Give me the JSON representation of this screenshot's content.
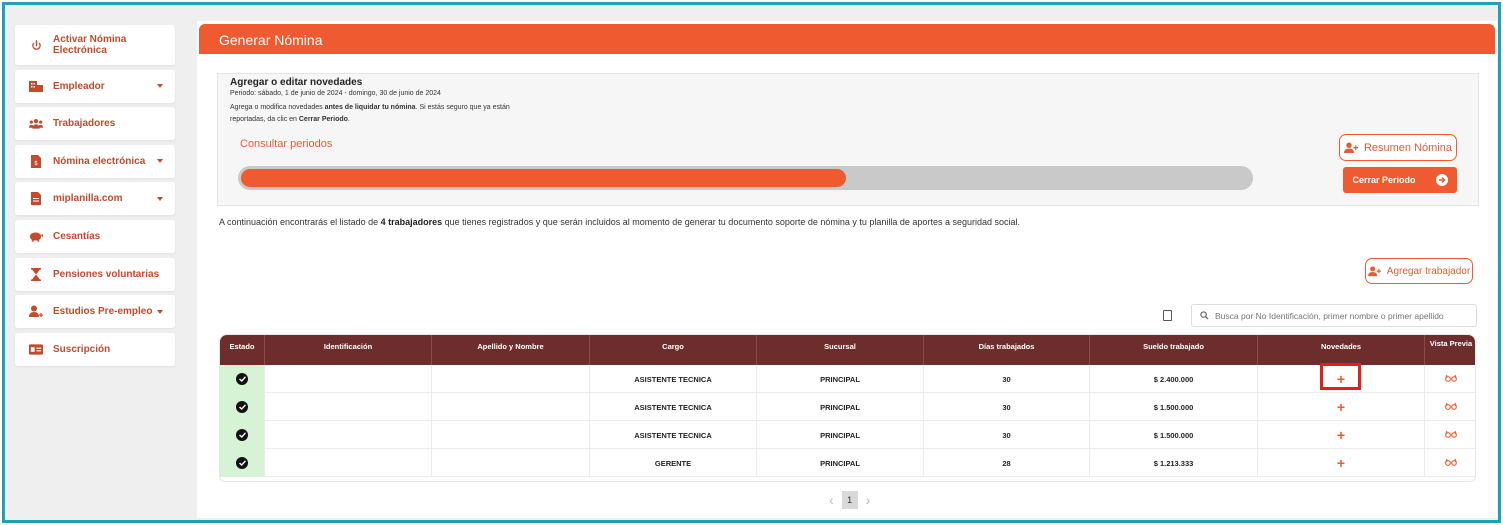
{
  "sidebar": {
    "items": [
      {
        "label": "Activar Nómina Electrónica",
        "icon": "power-icon",
        "dropdown": false
      },
      {
        "label": "Empleador",
        "icon": "building-icon",
        "dropdown": true
      },
      {
        "label": "Trabajadores",
        "icon": "users-icon",
        "dropdown": false
      },
      {
        "label": "Nómina electrónica",
        "icon": "document-icon",
        "dropdown": true
      },
      {
        "label": "miplanilla.com",
        "icon": "file-icon",
        "dropdown": true
      },
      {
        "label": "Cesantías",
        "icon": "piggy-bank-icon",
        "dropdown": false
      },
      {
        "label": "Pensiones voluntarias",
        "icon": "hourglass-icon",
        "dropdown": false
      },
      {
        "label": "Estudios Pre-empleo",
        "icon": "user-plus-icon",
        "dropdown": true
      },
      {
        "label": "Suscripción",
        "icon": "id-card-icon",
        "dropdown": false
      }
    ]
  },
  "header": {
    "title": "Generar Nómina"
  },
  "info": {
    "heading": "Agregar o editar novedades",
    "periodo": "Periodo: sábado, 1 de junio de 2024 - domingo, 30 de junio de 2024",
    "instr_1": "Agrega o modifica novedades ",
    "instr_bold": "antes de liquidar tu nómina",
    "instr_2": ". Si estás seguro que ya están reportadas, da clic en ",
    "instr_bold2": "Cerrar Periodo",
    "instr_3": ".",
    "consultar": "Consultar periodos",
    "progress_fraction": 0.6
  },
  "buttons": {
    "resumen": "Resumen Nómina",
    "cerrar": "Cerrar Periodo",
    "agregar": "Agregar trabajador"
  },
  "description": {
    "pre": "A continuación encontrarás el listado de ",
    "bold": "4 trabajadores",
    "post": " que tienes registrados y que serán incluidos al momento de generar tu documento soporte de nómina y tu planilla de aportes a seguridad social."
  },
  "search": {
    "placeholder": "Busca por No Identificación, primer nombre o primer apellido"
  },
  "table": {
    "headers": [
      "Estado",
      "Identificación",
      "Apellido y Nombre",
      "Cargo",
      "Sucursal",
      "Días trabajados",
      "Sueldo trabajado",
      "Novedades",
      "Vista Previa"
    ],
    "rows": [
      {
        "cargo": "ASISTENTE TECNICA",
        "sucursal": "PRINCIPAL",
        "dias": "30",
        "sueldo": "$ 2.400.000"
      },
      {
        "cargo": "ASISTENTE TECNICA",
        "sucursal": "PRINCIPAL",
        "dias": "30",
        "sueldo": "$ 1.500.000"
      },
      {
        "cargo": "ASISTENTE TECNICA",
        "sucursal": "PRINCIPAL",
        "dias": "30",
        "sueldo": "$ 1.500.000"
      },
      {
        "cargo": "GERENTE",
        "sucursal": "PRINCIPAL",
        "dias": "28",
        "sueldo": "$ 1.213.333"
      }
    ]
  },
  "pagination": {
    "current": "1"
  },
  "colors": {
    "accent": "#f05a30",
    "table_header": "#6e2d2d",
    "status_ok": "#d7f3d5",
    "frame": "#1fa2b6"
  }
}
